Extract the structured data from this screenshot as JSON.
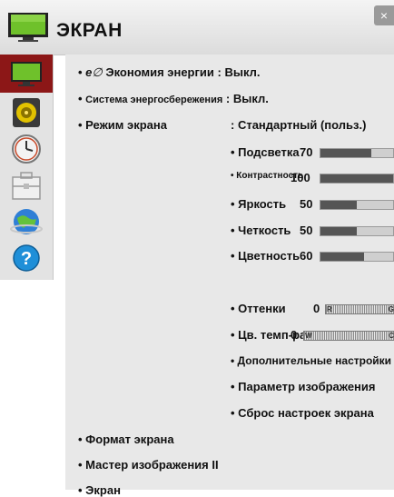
{
  "header": {
    "title": "ЭКРАН",
    "close_label": "×"
  },
  "tabs": [
    {
      "name": "picture"
    },
    {
      "name": "sound"
    },
    {
      "name": "time"
    },
    {
      "name": "options"
    },
    {
      "name": "network"
    },
    {
      "name": "support"
    }
  ],
  "menu": {
    "eco_label": "Экономия энергии : Выкл.",
    "eco_prefix": "e",
    "powersave_label": "Система энергосбережения",
    "powersave_value": ": Выкл.",
    "mode_label": "Режим экрана",
    "mode_value": ": Стандартный (польз.)",
    "settings": [
      {
        "label": "Подсветка",
        "value": "70",
        "level": 70
      },
      {
        "label": "Контрастность",
        "value": "100",
        "level": 100
      },
      {
        "label": "Яркость",
        "value": "50",
        "level": 50
      },
      {
        "label": "Четкость",
        "value": "50",
        "level": 50
      },
      {
        "label": "Цветность",
        "value": "60",
        "level": 60
      }
    ],
    "tint": {
      "label": "Оттенки",
      "value": "0",
      "left": "R",
      "right": "G"
    },
    "color_temp": {
      "label": "Цв. темп-ра",
      "value": "0",
      "left": "W",
      "right": "C"
    },
    "advanced": "Дополнительные настройки",
    "picture_option": "Параметр изображения",
    "reset": "Сброс настроек экрана",
    "aspect": "Формат экрана",
    "wizard": "Мастер изображения II",
    "screen": "Экран"
  },
  "colors": {
    "active_tab": "#8c1717",
    "bar_fill": "#555555"
  }
}
